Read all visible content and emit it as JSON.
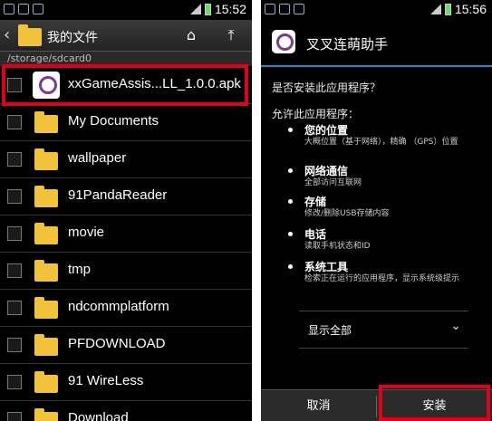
{
  "left": {
    "time": "15:52",
    "title": "我的文件",
    "path": "/storage/sdcard0",
    "files": [
      "xxGameAssis...LL_1.0.0.apk",
      "My Documents",
      "wallpaper",
      "91PandaReader",
      "movie",
      "tmp",
      "ndcommplatform",
      "PFDOWNLOAD",
      "91 WireLess",
      "Download"
    ]
  },
  "right": {
    "time": "15:56",
    "app_name": "叉叉连萌助手",
    "question": "是否安装此应用程序？",
    "allow": "允许此应用程序：",
    "permissions": [
      {
        "title": "您的位置",
        "desc": "大概位置（基于网络），精确 （GPS）位置"
      },
      {
        "title": "网络通信",
        "desc": "全部访问互联网"
      },
      {
        "title": "存储",
        "desc": "修改/删除USB存储内容"
      },
      {
        "title": "电话",
        "desc": "读取手机状态和ID"
      },
      {
        "title": "系统工具",
        "desc": "检索正在运行的应用程序，显示系统级提示"
      }
    ],
    "show_all": "显示全部",
    "cancel": "取消",
    "install": "安装"
  },
  "colors": {
    "highlight": "#e0001a",
    "accent": "#1f8fbf",
    "folder": "#f2c23b"
  }
}
